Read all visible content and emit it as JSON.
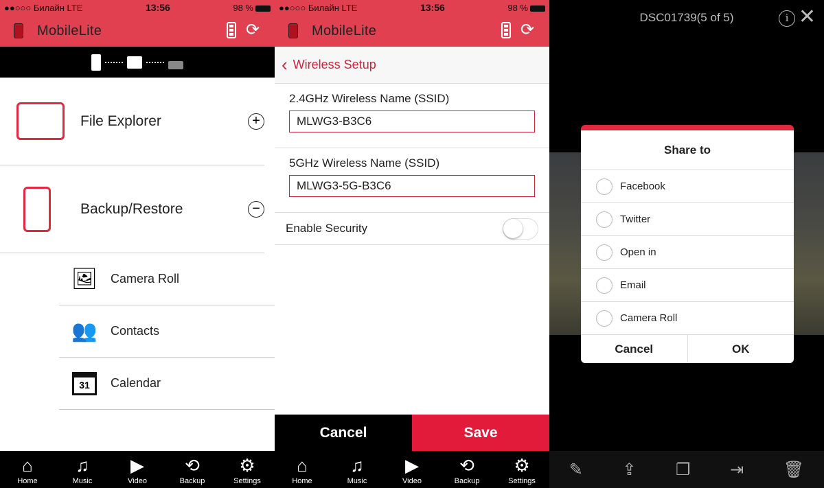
{
  "status": {
    "carrier": "●●○○○ Билайн  LTE",
    "time": "13:56",
    "battery": "98 %"
  },
  "app": {
    "brand": "MobileLite",
    "accent": "#e0404f"
  },
  "panel1": {
    "items": [
      {
        "label": "File Explorer",
        "toggle": "+"
      },
      {
        "label": "Backup/Restore",
        "toggle": "−"
      }
    ],
    "subitems": [
      {
        "label": "Camera Roll",
        "icon": "photo-icon"
      },
      {
        "label": "Contacts",
        "icon": "contacts-icon"
      },
      {
        "label": "Calendar",
        "icon": "calendar-icon",
        "day": "31"
      }
    ]
  },
  "tabs": [
    {
      "label": "Home",
      "icon": "⌂"
    },
    {
      "label": "Music",
      "icon": "♫"
    },
    {
      "label": "Video",
      "icon": "▶"
    },
    {
      "label": "Backup",
      "icon": "⟲"
    },
    {
      "label": "Settings",
      "icon": "⚙"
    }
  ],
  "panel2": {
    "back": "Wireless Setup",
    "fields": [
      {
        "label": "2.4GHz Wireless Name (SSID)",
        "value": "MLWG3-B3C6"
      },
      {
        "label": "5GHz Wireless Name (SSID)",
        "value": "MLWG3-5G-B3C6"
      }
    ],
    "security_label": "Enable Security",
    "security_enabled": false,
    "cancel": "Cancel",
    "save": "Save"
  },
  "panel3": {
    "title": "DSC01739(5 of 5)",
    "dialog": {
      "title": "Share to",
      "options": [
        "Facebook",
        "Twitter",
        "Open in",
        "Email",
        "Camera Roll"
      ],
      "cancel": "Cancel",
      "ok": "OK"
    },
    "toolbar": [
      "edit-icon",
      "share-icon",
      "copy-icon",
      "move-icon",
      "trash-icon"
    ]
  }
}
